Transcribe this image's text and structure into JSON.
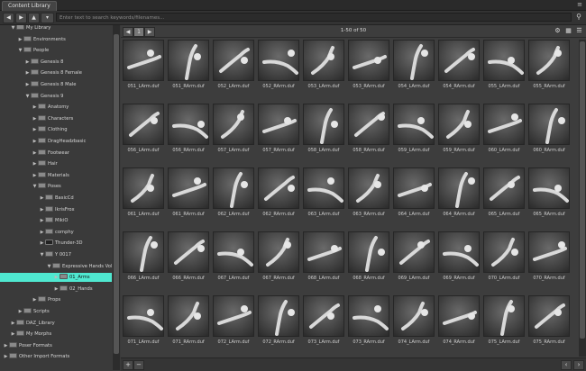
{
  "window": {
    "tab_label": "Content Library"
  },
  "toolbar": {
    "search_placeholder": "Enter text to search keywords/filenames..."
  },
  "tree": [
    {
      "label": "My Library",
      "depth": 1,
      "expanded": true,
      "person": false,
      "selected": false
    },
    {
      "label": "Environments",
      "depth": 2,
      "expanded": false,
      "person": false,
      "selected": false
    },
    {
      "label": "People",
      "depth": 2,
      "expanded": true,
      "person": false,
      "selected": false
    },
    {
      "label": "Genesis 8",
      "depth": 3,
      "expanded": false,
      "person": false,
      "selected": false
    },
    {
      "label": "Genesis 8 Female",
      "depth": 3,
      "expanded": false,
      "person": false,
      "selected": false
    },
    {
      "label": "Genesis 8 Male",
      "depth": 3,
      "expanded": false,
      "person": false,
      "selected": false
    },
    {
      "label": "Genesis 9",
      "depth": 3,
      "expanded": true,
      "person": false,
      "selected": false
    },
    {
      "label": "Anatomy",
      "depth": 4,
      "expanded": false,
      "person": false,
      "selected": false
    },
    {
      "label": "Characters",
      "depth": 4,
      "expanded": false,
      "person": false,
      "selected": false
    },
    {
      "label": "Clothing",
      "depth": 4,
      "expanded": false,
      "person": false,
      "selected": false
    },
    {
      "label": "DragHeadzbasic",
      "depth": 4,
      "expanded": false,
      "person": false,
      "selected": false
    },
    {
      "label": "Footwear",
      "depth": 4,
      "expanded": false,
      "person": false,
      "selected": false
    },
    {
      "label": "Hair",
      "depth": 4,
      "expanded": false,
      "person": false,
      "selected": false
    },
    {
      "label": "Materials",
      "depth": 4,
      "expanded": false,
      "person": false,
      "selected": false
    },
    {
      "label": "Poses",
      "depth": 4,
      "expanded": true,
      "person": false,
      "selected": false
    },
    {
      "label": "BasicCd",
      "depth": 5,
      "expanded": false,
      "person": false,
      "selected": false
    },
    {
      "label": "IkrisFrox",
      "depth": 5,
      "expanded": false,
      "person": false,
      "selected": false
    },
    {
      "label": "MikiO",
      "depth": 5,
      "expanded": false,
      "person": false,
      "selected": false
    },
    {
      "label": "comphy",
      "depth": 5,
      "expanded": false,
      "person": false,
      "selected": false
    },
    {
      "label": "Thunder-3D",
      "depth": 5,
      "expanded": false,
      "person": true,
      "selected": false
    },
    {
      "label": "Y 0017",
      "depth": 5,
      "expanded": true,
      "person": false,
      "selected": false
    },
    {
      "label": "Expressive Hands Vol.3",
      "depth": 6,
      "expanded": true,
      "person": false,
      "selected": false
    },
    {
      "label": "01_Arms",
      "depth": 7,
      "expanded": false,
      "person": false,
      "selected": true
    },
    {
      "label": "02_Hands",
      "depth": 7,
      "expanded": false,
      "person": false,
      "selected": false
    },
    {
      "label": "Props",
      "depth": 4,
      "expanded": false,
      "person": false,
      "selected": false
    },
    {
      "label": "Scripts",
      "depth": 2,
      "expanded": false,
      "person": false,
      "selected": false
    },
    {
      "label": "DAZ_Library",
      "depth": 1,
      "expanded": false,
      "person": false,
      "selected": false
    },
    {
      "label": "My Morphs",
      "depth": 1,
      "expanded": false,
      "person": false,
      "selected": false
    },
    {
      "label": "Poser Formats",
      "depth": 0,
      "expanded": false,
      "person": false,
      "selected": false
    },
    {
      "label": "Other Import Formats",
      "depth": 0,
      "expanded": false,
      "person": false,
      "selected": false
    }
  ],
  "pager": {
    "info": "1-50 of 50"
  },
  "items": [
    "051_LArm.duf",
    "051_RArm.duf",
    "052_LArm.duf",
    "052_RArm.duf",
    "053_LArm.duf",
    "053_RArm.duf",
    "054_LArm.duf",
    "054_RArm.duf",
    "055_LArm.duf",
    "055_RArm.duf",
    "056_LArm.duf",
    "056_RArm.duf",
    "057_LArm.duf",
    "057_RArm.duf",
    "058_LArm.duf",
    "058_RArm.duf",
    "059_LArm.duf",
    "059_RArm.duf",
    "060_LArm.duf",
    "060_RArm.duf",
    "061_LArm.duf",
    "061_RArm.duf",
    "062_LArm.duf",
    "062_RArm.duf",
    "063_LArm.duf",
    "063_RArm.duf",
    "064_LArm.duf",
    "064_RArm.duf",
    "065_LArm.duf",
    "065_RArm.duf",
    "066_LArm.duf",
    "066_RArm.duf",
    "067_LArm.duf",
    "067_RArm.duf",
    "068_LArm.duf",
    "068_RArm.duf",
    "069_LArm.duf",
    "069_RArm.duf",
    "070_LArm.duf",
    "070_RArm.duf",
    "071_LArm.duf",
    "071_RArm.duf",
    "072_LArm.duf",
    "072_RArm.duf",
    "073_LArm.duf",
    "073_RArm.duf",
    "074_LArm.duf",
    "074_RArm.duf",
    "075_LArm.duf",
    "075_RArm.duf"
  ],
  "colors": {
    "selection": "#4fe8d0"
  }
}
